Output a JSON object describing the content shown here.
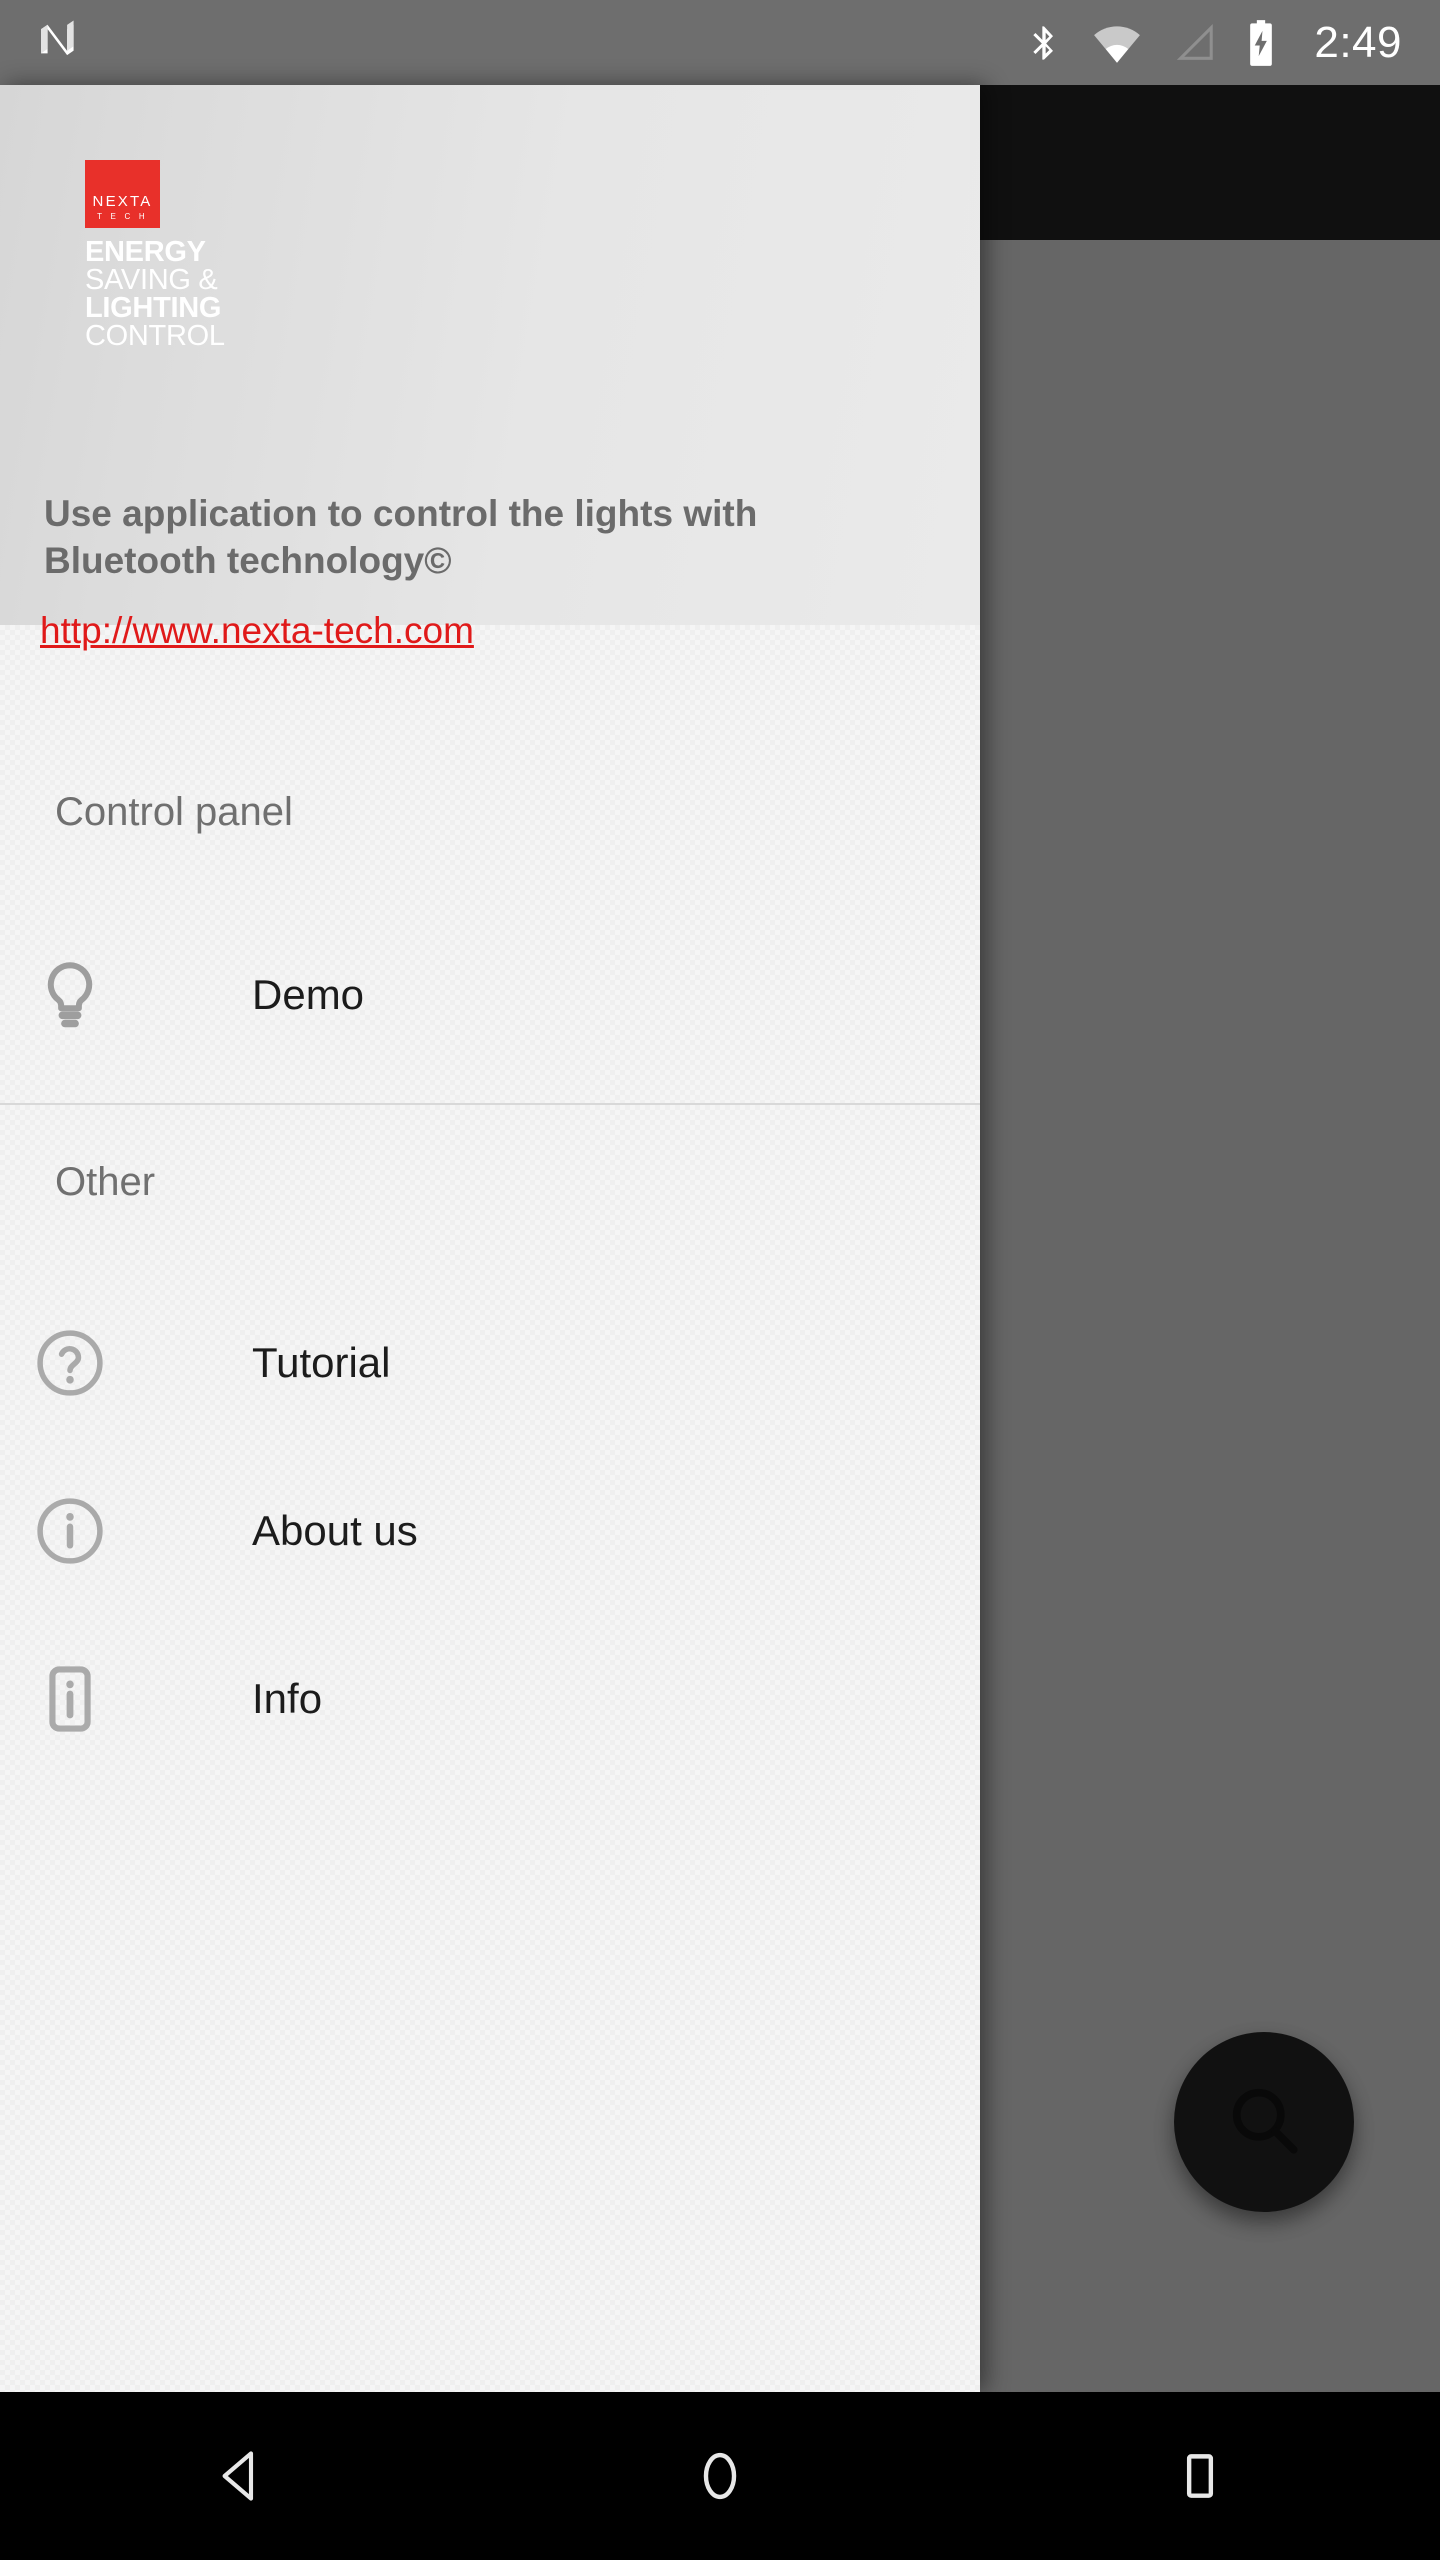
{
  "status_bar": {
    "platform_logo": "android-n-logo",
    "icons": [
      "bluetooth-icon",
      "wifi-icon",
      "cellular-signal-icon",
      "battery-charging-icon"
    ],
    "time": "2:49",
    "background_color": "#6e6e6e"
  },
  "drawer": {
    "header": {
      "logo": {
        "name": "NEXTA",
        "subtitle": "T E C H",
        "color": "#e8302a"
      },
      "tagline": [
        {
          "text": "ENERGY",
          "weight": "bold"
        },
        {
          "text": "SAVING &",
          "weight": "light"
        },
        {
          "text": "LIGHTING",
          "weight": "bold"
        },
        {
          "text": "CONTROL",
          "weight": "light"
        }
      ],
      "description": "Use application to control the lights with Bluetooth technology©",
      "link": "http://www.nexta-tech.com",
      "link_color": "#e01a1a"
    },
    "sections": [
      {
        "title": "Control panel",
        "items": [
          {
            "label": "Demo",
            "icon": "lightbulb-icon"
          }
        ]
      },
      {
        "title": "Other",
        "items": [
          {
            "label": "Tutorial",
            "icon": "help-circle-icon"
          },
          {
            "label": "About us",
            "icon": "info-circle-icon"
          },
          {
            "label": "Info",
            "icon": "device-info-icon"
          }
        ]
      }
    ]
  },
  "app": {
    "fab": {
      "icon": "search-icon",
      "label": "Search"
    }
  },
  "navigation_bar": {
    "buttons": [
      {
        "label": "Back",
        "icon": "back-triangle-icon"
      },
      {
        "label": "Home",
        "icon": "home-circle-icon"
      },
      {
        "label": "Recents",
        "icon": "recents-square-icon"
      }
    ],
    "background_color": "#000000"
  }
}
